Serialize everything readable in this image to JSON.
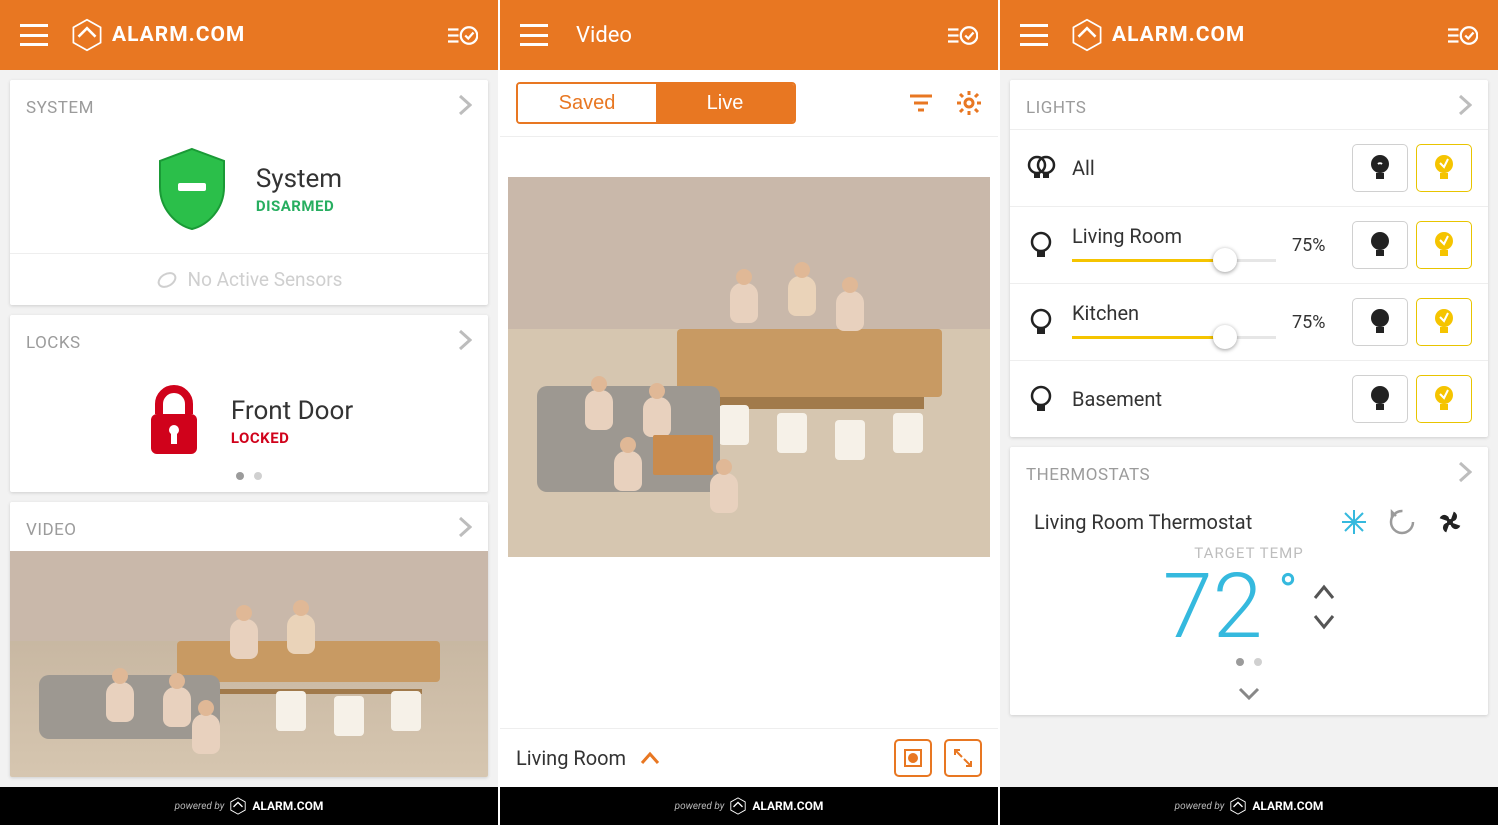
{
  "brand": "ALARM.COM",
  "footer": {
    "powered_by": "powered by",
    "brand": "ALARM.COM"
  },
  "screen1": {
    "system": {
      "heading": "SYSTEM",
      "title": "System",
      "status": "DISARMED",
      "no_sensors": "No Active Sensors"
    },
    "locks": {
      "heading": "LOCKS",
      "title": "Front Door",
      "status": "LOCKED"
    },
    "video": {
      "heading": "VIDEO"
    }
  },
  "screen2": {
    "title": "Video",
    "tabs": {
      "saved": "Saved",
      "live": "Live",
      "active": "live"
    },
    "camera_name": "Living Room"
  },
  "screen3": {
    "lights": {
      "heading": "LIGHTS",
      "rows": [
        {
          "name": "All",
          "slider": false
        },
        {
          "name": "Living Room",
          "slider": true,
          "pct": "75%"
        },
        {
          "name": "Kitchen",
          "slider": true,
          "pct": "75%"
        },
        {
          "name": "Basement",
          "slider": false
        }
      ]
    },
    "thermo": {
      "heading": "THERMOSTATS",
      "name": "Living Room Thermostat",
      "target_label": "TARGET TEMP",
      "temp": "72",
      "deg": "°"
    }
  }
}
